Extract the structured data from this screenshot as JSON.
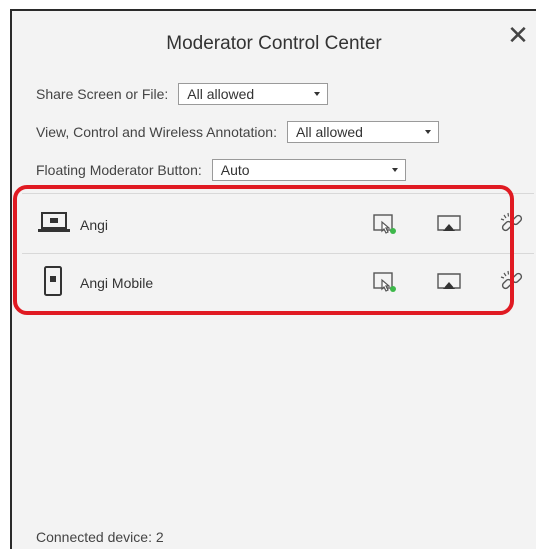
{
  "dialog": {
    "title": "Moderator Control Center",
    "close_glyph": "✕"
  },
  "settings": [
    {
      "label": "Share Screen or File:",
      "value": "All allowed"
    },
    {
      "label": "View, Control and Wireless Annotation:",
      "value": "All allowed"
    },
    {
      "label": "Floating Moderator Button:",
      "value": "Auto"
    }
  ],
  "devices": [
    {
      "name": "Angi",
      "type_icon": "laptop-icon",
      "actions": [
        "remote-control-icon",
        "screen-share-icon",
        "disconnect-link-icon"
      ]
    },
    {
      "name": "Angi Mobile",
      "type_icon": "mobile-phone-icon",
      "actions": [
        "remote-control-icon",
        "screen-share-icon",
        "disconnect-link-icon"
      ]
    }
  ],
  "footer": {
    "connected_label": "Connected device: 2"
  },
  "colors": {
    "highlight": "#e01a22",
    "status_green": "#3db84a",
    "background": "#f3f3f3"
  }
}
